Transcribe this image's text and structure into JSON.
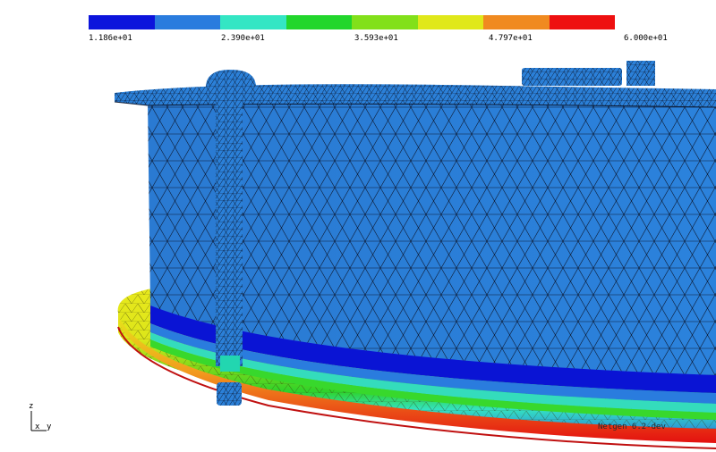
{
  "colorbar": {
    "colors": [
      "#0c14dc",
      "#2a7cde",
      "#34e6c4",
      "#22d62c",
      "#82e01a",
      "#e0e81a",
      "#f08a20",
      "#ee1010"
    ],
    "ticks": [
      "1.186e+01",
      "2.390e+01",
      "3.593e+01",
      "4.797e+01",
      "6.000e+01"
    ]
  },
  "axes": {
    "z": "z",
    "x": "x",
    "y": "y"
  },
  "footer": {
    "version": "Netgen 6.2-dev"
  },
  "colors": {
    "body": "#2a7bd4",
    "body_dark": "#2571c6",
    "mesh": "#0d1a33",
    "band_blue": "#0a14d4"
  }
}
